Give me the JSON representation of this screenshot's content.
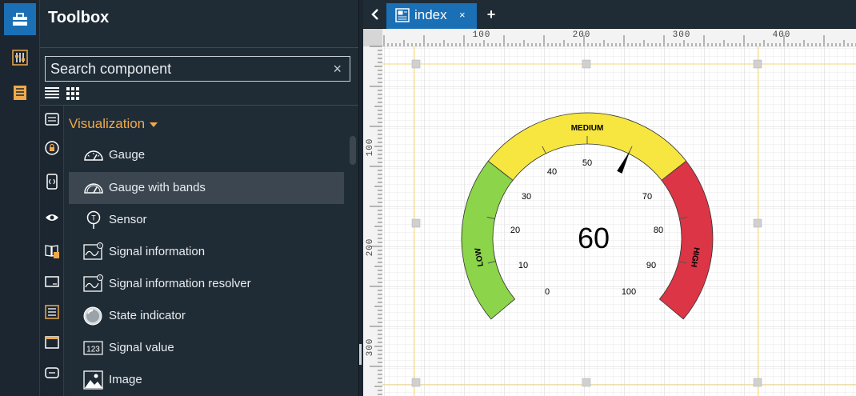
{
  "toolbox": {
    "title": "Toolbox",
    "search_placeholder": "Search component",
    "clear_glyph": "×"
  },
  "section": {
    "title": "Visualization"
  },
  "items": [
    {
      "label": "Gauge",
      "icon": "gauge-icon"
    },
    {
      "label": "Gauge with bands",
      "icon": "gauge-bands-icon",
      "selected": true
    },
    {
      "label": "Sensor",
      "icon": "sensor-icon"
    },
    {
      "label": "Signal information",
      "icon": "signal-info-icon"
    },
    {
      "label": "Signal information resolver",
      "icon": "signal-resolver-icon"
    },
    {
      "label": "State indicator",
      "icon": "state-indicator-icon"
    },
    {
      "label": "Signal value",
      "icon": "signal-value-icon"
    },
    {
      "label": "Image",
      "icon": "image-icon"
    }
  ],
  "tabs": {
    "active_label": "index",
    "close_glyph": "×",
    "add_glyph": "+"
  },
  "ruler": {
    "top_labels": [
      "100",
      "200",
      "300",
      "400"
    ],
    "left_labels": [
      "100",
      "200",
      "300"
    ]
  },
  "gauge": {
    "value": "60",
    "band_labels": [
      "LOW",
      "MEDIUM",
      "HIGH"
    ],
    "ticks": [
      "0",
      "10",
      "20",
      "30",
      "40",
      "50",
      "70",
      "80",
      "90",
      "100"
    ],
    "colors": {
      "low": "#8cd44a",
      "medium": "#f6e63f",
      "high": "#dc3545"
    }
  },
  "colors": {
    "accent": "#1a6fb5",
    "section": "#f0a94a",
    "panel": "#1f2c36"
  }
}
